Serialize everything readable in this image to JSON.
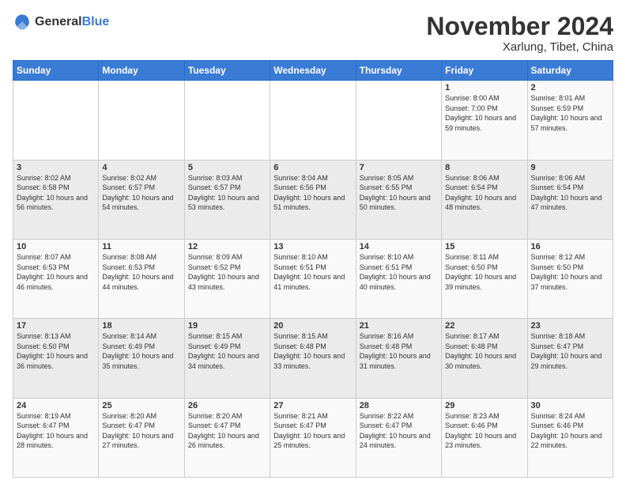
{
  "header": {
    "logo_general": "General",
    "logo_blue": "Blue",
    "month_title": "November 2024",
    "location": "Xarlung, Tibet, China"
  },
  "weekdays": [
    "Sunday",
    "Monday",
    "Tuesday",
    "Wednesday",
    "Thursday",
    "Friday",
    "Saturday"
  ],
  "rows": [
    [
      {
        "day": "",
        "info": ""
      },
      {
        "day": "",
        "info": ""
      },
      {
        "day": "",
        "info": ""
      },
      {
        "day": "",
        "info": ""
      },
      {
        "day": "",
        "info": ""
      },
      {
        "day": "1",
        "info": "Sunrise: 8:00 AM\nSunset: 7:00 PM\nDaylight: 10 hours and 59 minutes."
      },
      {
        "day": "2",
        "info": "Sunrise: 8:01 AM\nSunset: 6:59 PM\nDaylight: 10 hours and 57 minutes."
      }
    ],
    [
      {
        "day": "3",
        "info": "Sunrise: 8:02 AM\nSunset: 6:58 PM\nDaylight: 10 hours and 56 minutes."
      },
      {
        "day": "4",
        "info": "Sunrise: 8:02 AM\nSunset: 6:57 PM\nDaylight: 10 hours and 54 minutes."
      },
      {
        "day": "5",
        "info": "Sunrise: 8:03 AM\nSunset: 6:57 PM\nDaylight: 10 hours and 53 minutes."
      },
      {
        "day": "6",
        "info": "Sunrise: 8:04 AM\nSunset: 6:56 PM\nDaylight: 10 hours and 51 minutes."
      },
      {
        "day": "7",
        "info": "Sunrise: 8:05 AM\nSunset: 6:55 PM\nDaylight: 10 hours and 50 minutes."
      },
      {
        "day": "8",
        "info": "Sunrise: 8:06 AM\nSunset: 6:54 PM\nDaylight: 10 hours and 48 minutes."
      },
      {
        "day": "9",
        "info": "Sunrise: 8:06 AM\nSunset: 6:54 PM\nDaylight: 10 hours and 47 minutes."
      }
    ],
    [
      {
        "day": "10",
        "info": "Sunrise: 8:07 AM\nSunset: 6:53 PM\nDaylight: 10 hours and 46 minutes."
      },
      {
        "day": "11",
        "info": "Sunrise: 8:08 AM\nSunset: 6:53 PM\nDaylight: 10 hours and 44 minutes."
      },
      {
        "day": "12",
        "info": "Sunrise: 8:09 AM\nSunset: 6:52 PM\nDaylight: 10 hours and 43 minutes."
      },
      {
        "day": "13",
        "info": "Sunrise: 8:10 AM\nSunset: 6:51 PM\nDaylight: 10 hours and 41 minutes."
      },
      {
        "day": "14",
        "info": "Sunrise: 8:10 AM\nSunset: 6:51 PM\nDaylight: 10 hours and 40 minutes."
      },
      {
        "day": "15",
        "info": "Sunrise: 8:11 AM\nSunset: 6:50 PM\nDaylight: 10 hours and 39 minutes."
      },
      {
        "day": "16",
        "info": "Sunrise: 8:12 AM\nSunset: 6:50 PM\nDaylight: 10 hours and 37 minutes."
      }
    ],
    [
      {
        "day": "17",
        "info": "Sunrise: 8:13 AM\nSunset: 6:50 PM\nDaylight: 10 hours and 36 minutes."
      },
      {
        "day": "18",
        "info": "Sunrise: 8:14 AM\nSunset: 6:49 PM\nDaylight: 10 hours and 35 minutes."
      },
      {
        "day": "19",
        "info": "Sunrise: 8:15 AM\nSunset: 6:49 PM\nDaylight: 10 hours and 34 minutes."
      },
      {
        "day": "20",
        "info": "Sunrise: 8:15 AM\nSunset: 6:48 PM\nDaylight: 10 hours and 33 minutes."
      },
      {
        "day": "21",
        "info": "Sunrise: 8:16 AM\nSunset: 6:48 PM\nDaylight: 10 hours and 31 minutes."
      },
      {
        "day": "22",
        "info": "Sunrise: 8:17 AM\nSunset: 6:48 PM\nDaylight: 10 hours and 30 minutes."
      },
      {
        "day": "23",
        "info": "Sunrise: 8:18 AM\nSunset: 6:47 PM\nDaylight: 10 hours and 29 minutes."
      }
    ],
    [
      {
        "day": "24",
        "info": "Sunrise: 8:19 AM\nSunset: 6:47 PM\nDaylight: 10 hours and 28 minutes."
      },
      {
        "day": "25",
        "info": "Sunrise: 8:20 AM\nSunset: 6:47 PM\nDaylight: 10 hours and 27 minutes."
      },
      {
        "day": "26",
        "info": "Sunrise: 8:20 AM\nSunset: 6:47 PM\nDaylight: 10 hours and 26 minutes."
      },
      {
        "day": "27",
        "info": "Sunrise: 8:21 AM\nSunset: 6:47 PM\nDaylight: 10 hours and 25 minutes."
      },
      {
        "day": "28",
        "info": "Sunrise: 8:22 AM\nSunset: 6:47 PM\nDaylight: 10 hours and 24 minutes."
      },
      {
        "day": "29",
        "info": "Sunrise: 8:23 AM\nSunset: 6:46 PM\nDaylight: 10 hours and 23 minutes."
      },
      {
        "day": "30",
        "info": "Sunrise: 8:24 AM\nSunset: 6:46 PM\nDaylight: 10 hours and 22 minutes."
      }
    ]
  ]
}
